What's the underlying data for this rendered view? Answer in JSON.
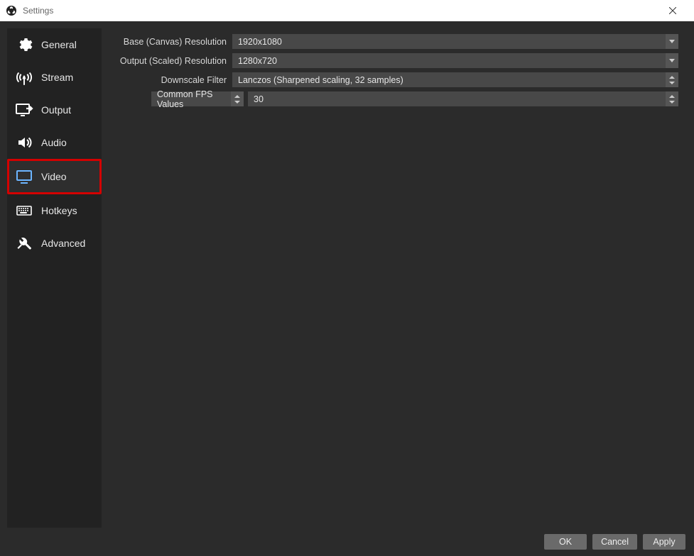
{
  "window": {
    "title": "Settings"
  },
  "sidebar": {
    "items": [
      {
        "label": "General"
      },
      {
        "label": "Stream"
      },
      {
        "label": "Output"
      },
      {
        "label": "Audio"
      },
      {
        "label": "Video"
      },
      {
        "label": "Hotkeys"
      },
      {
        "label": "Advanced"
      }
    ],
    "active_index": 4
  },
  "video": {
    "base_label": "Base (Canvas) Resolution",
    "base_value": "1920x1080",
    "output_label": "Output (Scaled) Resolution",
    "output_value": "1280x720",
    "filter_label": "Downscale Filter",
    "filter_value": "Lanczos (Sharpened scaling, 32 samples)",
    "fps_mode_label": "Common FPS Values",
    "fps_value": "30"
  },
  "buttons": {
    "ok": "OK",
    "cancel": "Cancel",
    "apply": "Apply"
  }
}
